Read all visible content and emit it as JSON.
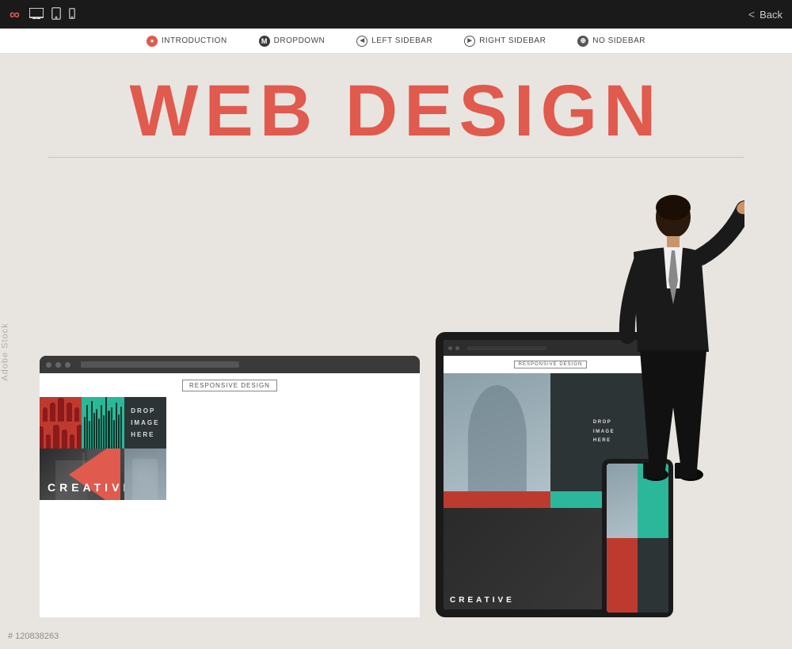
{
  "toolbar": {
    "logo": "CO",
    "infinity_symbol": "∞",
    "back_label": "Back",
    "chevron_label": "<"
  },
  "navbar": {
    "items": [
      {
        "icon": "●",
        "label": "INTRODUCTION"
      },
      {
        "icon": "M",
        "label": "DROPDOWN"
      },
      {
        "icon": "◄",
        "label": "LEFT SIDEBAR"
      },
      {
        "icon": "►",
        "label": "RIGHT SIDEBAR"
      },
      {
        "icon": "⊕",
        "label": "NO SIDEBAR"
      }
    ]
  },
  "main": {
    "title": "WEB DESIGN",
    "responsive_label": "RESPONSIVE DESIGN",
    "creative_label": "CREATIVE",
    "drop_image_lines": [
      "DROP",
      "IMAGE",
      "HERE"
    ]
  },
  "watermark": {
    "adobe": "Adobe Stock",
    "stock_number": "# 120838263"
  }
}
